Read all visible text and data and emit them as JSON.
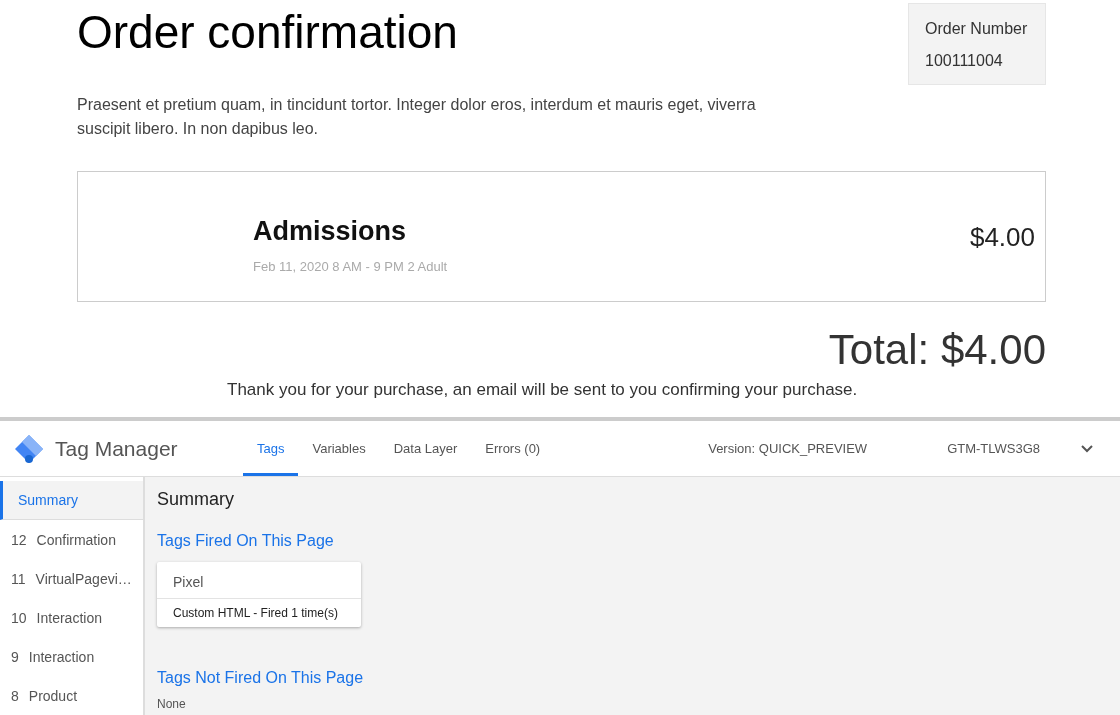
{
  "page": {
    "title": "Order confirmation",
    "order_box": {
      "label": "Order Number",
      "value": "100111004"
    },
    "intro": "Praesent et pretium quam, in tincidunt tortor. Integer dolor eros, interdum et mauris eget, viverra suscipit libero. In non dapibus leo.",
    "items": [
      {
        "name": "Admissions",
        "details": "Feb 11, 2020 8 AM - 9 PM 2 Adult",
        "price": "$4.00"
      }
    ],
    "total": "Total: $4.00",
    "thanks": "Thank you for your purchase, an email will be sent to you confirming your purchase."
  },
  "debug_panel": {
    "brand": "Tag Manager",
    "tabs": [
      {
        "label": "Tags",
        "selected": true
      },
      {
        "label": "Variables",
        "selected": false
      },
      {
        "label": "Data Layer",
        "selected": false
      },
      {
        "label": "Errors (0)",
        "selected": false
      }
    ],
    "version": "Version: QUICK_PREVIEW",
    "container_id": "GTM-TLWS3G8",
    "sidebar": {
      "items": [
        {
          "label": "Summary",
          "selected": true
        },
        {
          "number": "12",
          "label": "Confirmation",
          "selected": false
        },
        {
          "number": "11",
          "label": "VirtualPagevi…",
          "selected": false
        },
        {
          "number": "10",
          "label": "Interaction",
          "selected": false
        },
        {
          "number": "9",
          "label": "Interaction",
          "selected": false
        },
        {
          "number": "8",
          "label": "Product",
          "selected": false
        }
      ]
    },
    "main": {
      "title": "Summary",
      "fired": {
        "heading": "Tags Fired On This Page",
        "tags": [
          {
            "name": "Pixel",
            "status": "Custom HTML - Fired 1 time(s)"
          }
        ]
      },
      "not_fired": {
        "heading": "Tags Not Fired On This Page",
        "empty_text": "None"
      }
    }
  }
}
